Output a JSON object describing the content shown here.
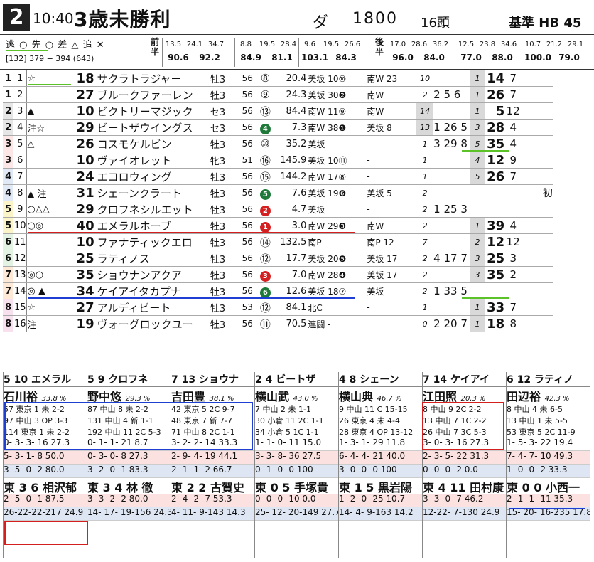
{
  "header": {
    "race_no": "2",
    "time": "10:40",
    "title": "3歳未勝利",
    "surface": "ダ",
    "distance": "1800",
    "heads": "16頭",
    "hb_label": "基準 HB",
    "hb_value": "45"
  },
  "legend": {
    "marks": "逃 ○ 先 ○ 差 △ 追 ✕",
    "laps": "[132] 379 − 394 (643)",
    "zenhan": "前半",
    "kohan": "後半"
  },
  "laps": {
    "front": [
      {
        "top": [
          "13.5",
          "24.1",
          "34.7"
        ],
        "bot": [
          "90.6",
          "92.2"
        ]
      },
      {
        "top": [
          "8.8",
          "19.5",
          "28.4"
        ],
        "bot": [
          "84.9",
          "81.1"
        ]
      },
      {
        "top": [
          "9.6",
          "19.5",
          "26.6"
        ],
        "bot": [
          "103.1",
          "84.3"
        ]
      }
    ],
    "back": [
      {
        "top": [
          "17.0",
          "28.6",
          "36.2"
        ],
        "bot": [
          "96.0",
          "84.0"
        ]
      },
      {
        "top": [
          "12.5",
          "23.8",
          "34.6"
        ],
        "bot": [
          "77.0",
          "88.0"
        ]
      },
      {
        "top": [
          "10.7",
          "21.2",
          "29.1"
        ],
        "bot": [
          "100.0",
          "79.0"
        ]
      }
    ]
  },
  "entries": [
    {
      "w": "1",
      "u": "1",
      "mk": "☆",
      "sc": "18",
      "nm": "サクラトラジャー",
      "sx": "牡3",
      "wt": "56",
      "pp": "⑧",
      "ppst": "o",
      "od": "20.4",
      "t1": "美坂 10⑩",
      "t2": "南W 23",
      "gr": "10",
      "tr": "",
      "rk": "1",
      "r2": "14",
      "r3": "7",
      "rb": ""
    },
    {
      "w": "1",
      "u": "2",
      "mk": "",
      "sc": "27",
      "nm": "ブルークファーレン",
      "sx": "牡3",
      "wt": "56",
      "pp": "⑨",
      "ppst": "o",
      "od": "24.3",
      "t1": "美坂 30❷",
      "t2": "南W",
      "gr": "2",
      "tr": "2  5 6",
      "rk": "1",
      "r2": "26",
      "r3": "7",
      "rb": ""
    },
    {
      "w": "2",
      "u": "3",
      "mk": "▲",
      "sc": "10",
      "nm": "ビクトリーマジック",
      "sx": "セ3",
      "wt": "56",
      "pp": "⑬",
      "ppst": "o",
      "od": "84.4",
      "t1": "南W 11⑨",
      "t2": "南W",
      "gr": "14",
      "tr": "",
      "rk": "1",
      "r2": "5",
      "r3": "12",
      "rb": ""
    },
    {
      "w": "2",
      "u": "4",
      "mk": "注☆",
      "sc": "29",
      "nm": "ビートザウイングス",
      "sx": "セ3",
      "wt": "56",
      "pp": "4",
      "ppst": "g",
      "od": "7.3",
      "t1": "南W 38❶",
      "t2": "美坂 8",
      "gr": "13",
      "tr": "1 26 5",
      "rk": "3",
      "r2": "28",
      "r3": "4",
      "rb": ""
    },
    {
      "w": "3",
      "u": "5",
      "mk": "△",
      "sc": "26",
      "nm": "コスモケルビン",
      "sx": "牡3",
      "wt": "56",
      "pp": "⑩",
      "ppst": "o",
      "od": "35.2",
      "t1": "美坂",
      "t2": "-",
      "gr": "1",
      "tr": "3 29 8",
      "rk": "5",
      "r2": "35",
      "r3": "4",
      "rb": ""
    },
    {
      "w": "3",
      "u": "6",
      "mk": "",
      "sc": "10",
      "nm": "ヴァイオレット",
      "sx": "牝3",
      "wt": "51",
      "pp": "⑯",
      "ppst": "o",
      "od": "145.9",
      "t1": "美坂 10⑪",
      "t2": "-",
      "gr": "1",
      "tr": "",
      "rk": "4",
      "r2": "12",
      "r3": "9",
      "rb": ""
    },
    {
      "w": "4",
      "u": "7",
      "mk": "",
      "sc": "24",
      "nm": "エコロウィング",
      "sx": "牡3",
      "wt": "56",
      "pp": "⑮",
      "ppst": "o",
      "od": "144.2",
      "t1": "南W 17⑧",
      "t2": "-",
      "gr": "1",
      "tr": "",
      "rk": "5",
      "r2": "26",
      "r3": "7",
      "rb": ""
    },
    {
      "w": "4",
      "u": "8",
      "mk": "▲ 注",
      "sc": "31",
      "nm": "シェーンクラート",
      "sx": "牡3",
      "wt": "56",
      "pp": "5",
      "ppst": "g",
      "od": "7.6",
      "t1": "美坂 19❻",
      "t2": "美坂 5",
      "gr": "2",
      "tr": "",
      "rk": "",
      "r2": "",
      "r3": "",
      "rb": "初"
    },
    {
      "w": "5",
      "u": "9",
      "mk": "○△△",
      "sc": "29",
      "nm": "クロフネシルエット",
      "sx": "牡3",
      "wt": "56",
      "pp": "2",
      "ppst": "r",
      "od": "4.7",
      "t1": "美坂",
      "t2": "-",
      "gr": "2",
      "tr": "1 25 3",
      "rk": "",
      "r2": "",
      "r3": "",
      "rb": ""
    },
    {
      "w": "5",
      "u": "10",
      "mk": "○◎",
      "sc": "40",
      "nm": "エメラルホープ",
      "sx": "牡3",
      "wt": "56",
      "pp": "1",
      "ppst": "r",
      "od": "3.0",
      "t1": "南W 29❸",
      "t2": "南W",
      "gr": "2",
      "tr": "",
      "rk": "1",
      "r2": "39",
      "r3": "4",
      "rb": ""
    },
    {
      "w": "6",
      "u": "11",
      "mk": "",
      "sc": "10",
      "nm": "ファナティックエロ",
      "sx": "牡3",
      "wt": "56",
      "pp": "⑭",
      "ppst": "o",
      "od": "132.5",
      "t1": "南P",
      "t2": "南P 12",
      "gr": "7",
      "tr": "",
      "rk": "2",
      "r2": "12",
      "r3": "12",
      "rb": ""
    },
    {
      "w": "6",
      "u": "12",
      "mk": "",
      "sc": "25",
      "nm": "ラティノス",
      "sx": "牡3",
      "wt": "56",
      "pp": "⑫",
      "ppst": "o",
      "od": "17.7",
      "t1": "美坂 20❺",
      "t2": "美坂 17",
      "gr": "2",
      "tr": "4 17 7",
      "rk": "3",
      "r2": "25",
      "r3": "3",
      "rb": ""
    },
    {
      "w": "7",
      "u": "13",
      "mk": "◎○",
      "sc": "35",
      "nm": "ショウナンアクア",
      "sx": "牡3",
      "wt": "56",
      "pp": "3",
      "ppst": "r",
      "od": "7.0",
      "t1": "南W 28❹",
      "t2": "美坂 17",
      "gr": "2",
      "tr": "",
      "rk": "3",
      "r2": "35",
      "r3": "2",
      "rb": ""
    },
    {
      "w": "7",
      "u": "14",
      "mk": "◎ ▲",
      "sc": "34",
      "nm": "ケイアイタカプナ",
      "sx": "牡3",
      "wt": "56",
      "pp": "6",
      "ppst": "g",
      "od": "12.6",
      "t1": "美坂 18⑦",
      "t2": "美坂",
      "gr": "2",
      "tr": "1 33 5",
      "rk": "",
      "r2": "",
      "r3": "",
      "rb": ""
    },
    {
      "w": "8",
      "u": "15",
      "mk": "☆",
      "sc": "27",
      "nm": "アルディビート",
      "sx": "牡3",
      "wt": "53",
      "pp": "⑫",
      "ppst": "o",
      "od": "84.1",
      "t1": "北C",
      "t2": "-",
      "gr": "1",
      "tr": "",
      "rk": "1",
      "r2": "33",
      "r3": "7",
      "rb": ""
    },
    {
      "w": "8",
      "u": "16",
      "mk": "注",
      "sc": "19",
      "nm": "ヴォーグロックユー",
      "sx": "牡3",
      "wt": "56",
      "pp": "⑪",
      "ppst": "o",
      "od": "70.5",
      "t1": "連闘 -",
      "t2": "-",
      "gr": "0",
      "tr": "2 20 7",
      "rk": "1",
      "r2": "18",
      "r3": "8",
      "rb": ""
    }
  ],
  "jockeys": [
    {
      "head": "5 10 エメラル",
      "name": "石川裕",
      "pct": "33.8 %",
      "recs": [
        "57 東京 1 未 2-2",
        "97 中山 3 OP 3-3",
        "114 東京 1 未 2-2"
      ],
      "s1": "0- 3- 3- 16 27.3",
      "s2": "5- 3- 1- 8 50.0",
      "s3": "3- 5- 0- 2 80.0",
      "trainer": "東 3 6 相沢郁",
      "t1": "2- 5- 0- 1 87.5",
      "t2": "26-22-22-217 24.9"
    },
    {
      "head": "5 9 クロフネ",
      "name": "野中悠",
      "pct": "29.3 %",
      "recs": [
        "87 中山 8 未 2-2",
        "131 中山 4 新 1-1",
        "192 中山 11 2C 5-3"
      ],
      "s1": "0- 1- 1- 21 8.7",
      "s2": "0- 3- 0- 8 27.3",
      "s3": "3- 2- 0- 1 83.3",
      "trainer": "東 3 4 林 徹",
      "t1": "3- 3- 2- 2 80.0",
      "t2": "14- 17- 19-156 24.3"
    },
    {
      "head": "7 13 ショウナ",
      "name": "吉田豊",
      "pct": "38.1 %",
      "recs": [
        "42 東京 5 2C 9-7",
        "48 東京 7 新 7-7",
        "71 中山 8 2C 1-1"
      ],
      "s1": "3- 2- 2- 14 33.3",
      "s2": "2- 9- 4- 19 44.1",
      "s3": "2- 1- 1- 2 66.7",
      "trainer": "東 2 2 古賀史",
      "t1": "2- 4- 2- 7 53.3",
      "t2": "4- 11- 9-143 14.3"
    },
    {
      "head": "2 4 ビートザ",
      "name": "横山武",
      "pct": "43.0 %",
      "recs": [
        "7 中山 2 未 1-1",
        "30 小倉 11 2C 1-1",
        "34 小倉 5 1C 1-1"
      ],
      "s1": "1- 1- 0- 11 15.0",
      "s2": "3- 3- 8- 36 27.5",
      "s3": "0- 1- 0- 0 100",
      "trainer": "東 0 5 手塚貴",
      "t1": "0- 0- 0- 10 0.0",
      "t2": "25- 12- 20-149 27.7"
    },
    {
      "head": "4 8 シェーン",
      "name": "横山典",
      "pct": "46.7 %",
      "recs": [
        "9 中山 11 C 15-15",
        "26 東京 4 未 4-4",
        "28 東京 4 OP 13-12"
      ],
      "s1": "1- 3- 1- 29 11.8",
      "s2": "6- 4- 4- 21 40.0",
      "s3": "3- 0- 0- 0 100",
      "trainer": "東 1 5 黒岩陽",
      "t1": "1- 2- 0- 25 10.7",
      "t2": "14- 4- 9-163 14.2"
    },
    {
      "head": "7 14 ケイアイ",
      "name": "江田照",
      "pct": "20.3 %",
      "recs": [
        "8 中山 9 2C 2-2",
        "13 中山 7 1C 2-2",
        "26 中山 7 3C 5-3"
      ],
      "s1": "3- 0- 3- 16 27.3",
      "s2": "2- 3- 5- 22 31.3",
      "s3": "0- 0- 0- 2 0.0",
      "trainer": "東 4 11 田村康",
      "t1": "3- 3- 0- 7 46.2",
      "t2": "12-22- 7-130 24.9"
    },
    {
      "head": "6 12 ラティノ",
      "name": "田辺裕",
      "pct": "42.3 %",
      "recs": [
        "8 中山 4 未 6-5",
        "13 中山 1 未 5-5",
        "53 東京 5 2C 11-9"
      ],
      "s1": "1- 5- 3- 22 19.4",
      "s2": "7- 4- 7- 10 49.3",
      "s3": "1- 0- 0- 2 33.3",
      "trainer": "東 0 0 小西一",
      "t1": "2- 1- 1- 11 35.3",
      "t2": "15- 20- 16-235 17.8"
    }
  ]
}
